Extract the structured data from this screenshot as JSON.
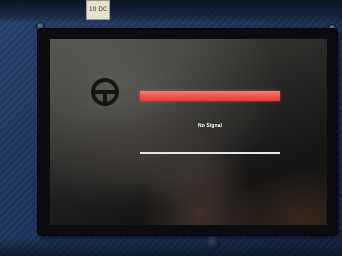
{
  "scene": {
    "sticker_text": "10 DC",
    "osd": {
      "message": "No Signal",
      "top_bar_color": "#f0544b",
      "bottom_bar_color": "#e6e6e6"
    },
    "colors": {
      "panel_background": "#1d3157",
      "monitor_bezel": "#0c0c10"
    }
  }
}
